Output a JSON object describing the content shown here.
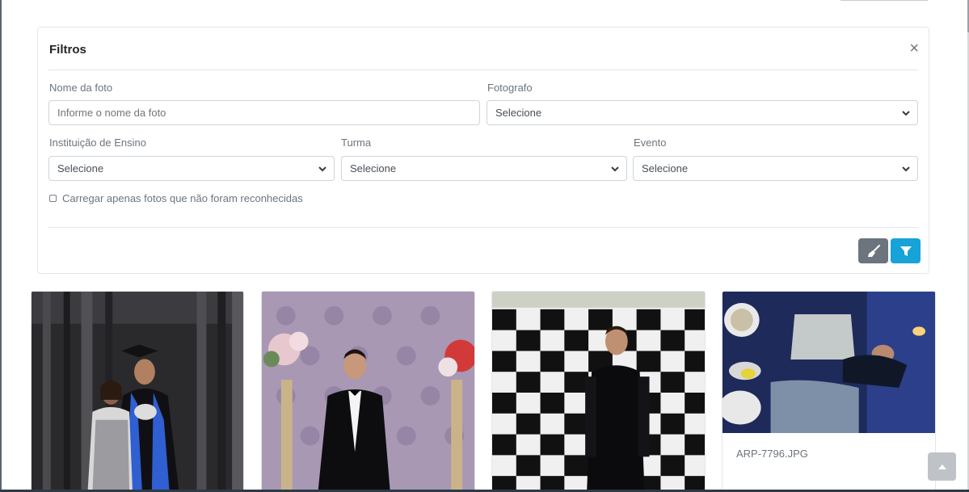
{
  "filters": {
    "title": "Filtros",
    "close_glyph": "×",
    "photo_name_label": "Nome da foto",
    "photo_name_placeholder": "Informe o nome da foto",
    "photo_name_value": "",
    "photographer_label": "Fotografo",
    "photographer_selected": "Selecione",
    "institution_label": "Instituição de Ensino",
    "institution_selected": "Selecione",
    "class_label": "Turma",
    "class_selected": "Selecione",
    "event_label": "Evento",
    "event_selected": "Selecione",
    "unrecognized_only_label": "Carregar apenas fotos que não foram reconhecidas",
    "unrecognized_only_checked": false,
    "clear_button_icon": "broom-icon",
    "apply_button_icon": "filter-icon"
  },
  "photos": [
    {
      "caption": ""
    },
    {
      "caption": ""
    },
    {
      "caption": ""
    },
    {
      "caption": "ARP-7796.JPG"
    }
  ],
  "colors": {
    "primary": "#17a2d8",
    "secondary": "#6c757d",
    "border": "#ced4da"
  },
  "scroll_top_icon": "caret-up-icon"
}
